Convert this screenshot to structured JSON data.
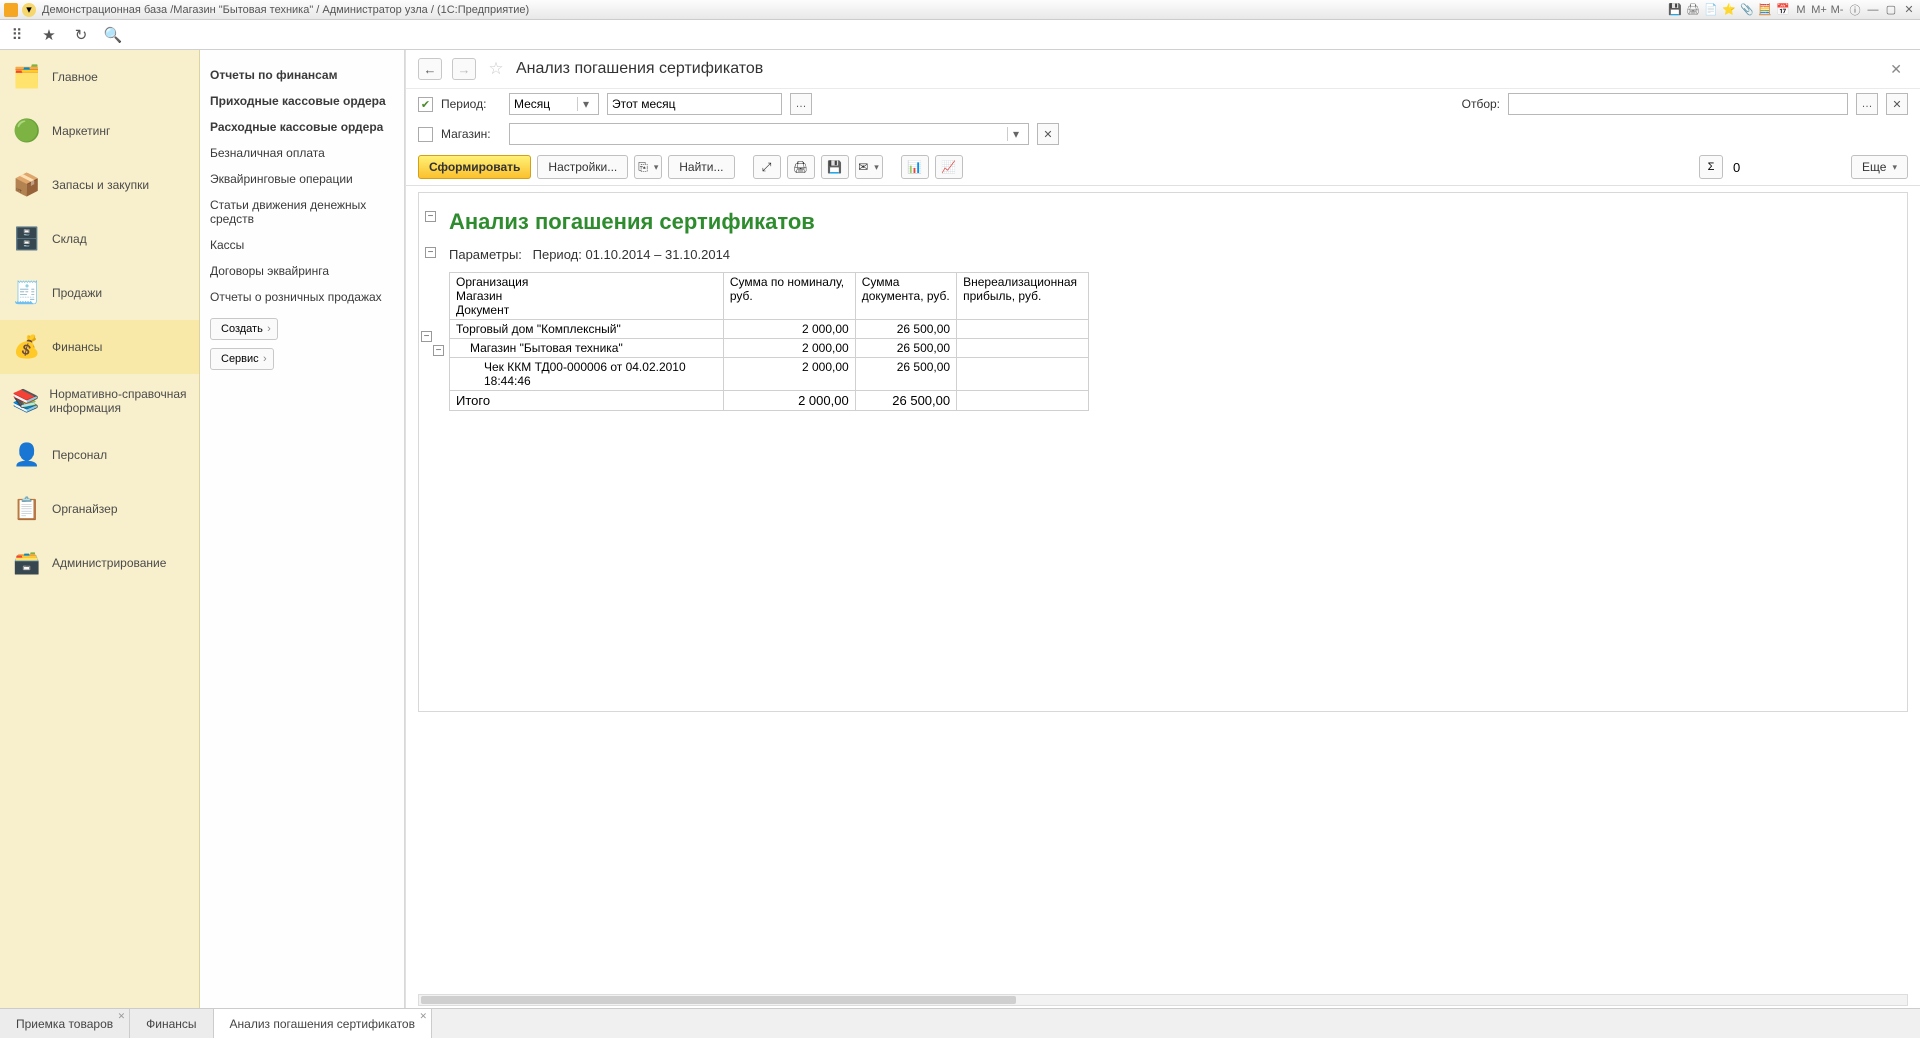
{
  "titlebar": {
    "text": "Демонстрационная база /Магазин \"Бытовая техника\" / Администратор узла /  (1С:Предприятие)",
    "mem": [
      "M",
      "M+",
      "M-"
    ]
  },
  "sidebar": {
    "items": [
      {
        "label": "Главное",
        "icon": "🗂️"
      },
      {
        "label": "Маркетинг",
        "icon": "🟢"
      },
      {
        "label": "Запасы и закупки",
        "icon": "📦"
      },
      {
        "label": "Склад",
        "icon": "🗄️"
      },
      {
        "label": "Продажи",
        "icon": "🧾"
      },
      {
        "label": "Финансы",
        "icon": "💰",
        "active": true
      },
      {
        "label": "Нормативно-справочная информация",
        "icon": "📚"
      },
      {
        "label": "Персонал",
        "icon": "👤"
      },
      {
        "label": "Органайзер",
        "icon": "📋"
      },
      {
        "label": "Администрирование",
        "icon": "🗃️"
      }
    ]
  },
  "submenu": {
    "items": [
      {
        "label": "Отчеты по финансам",
        "bold": true
      },
      {
        "label": "Приходные кассовые ордера",
        "bold": true
      },
      {
        "label": "Расходные кассовые ордера",
        "bold": true
      },
      {
        "label": "Безналичная оплата"
      },
      {
        "label": "Эквайринговые операции"
      },
      {
        "label": "Статьи движения денежных средств"
      },
      {
        "label": "Кассы"
      },
      {
        "label": "Договоры эквайринга"
      },
      {
        "label": "Отчеты о розничных продажах"
      }
    ],
    "buttons": [
      {
        "label": "Создать"
      },
      {
        "label": "Сервис"
      }
    ]
  },
  "content": {
    "title": "Анализ погашения сертификатов",
    "filters": {
      "period_label": "Период:",
      "period_type": "Месяц",
      "period_value": "Этот месяц",
      "selection_label": "Отбор:",
      "selection_value": "",
      "store_label": "Магазин:",
      "store_value": ""
    },
    "toolbar": {
      "generate": "Сформировать",
      "settings": "Настройки...",
      "find": "Найти...",
      "sum_value": "0",
      "more": "Еще"
    },
    "report": {
      "title": "Анализ погашения сертификатов",
      "params_label": "Параметры:",
      "params_value": "Период: 01.10.2014 – 31.10.2014",
      "headers": {
        "c1a": "Организация",
        "c1b": "Магазин",
        "c1c": "Документ",
        "c2": "Сумма по номиналу, руб.",
        "c3": "Сумма документа, руб.",
        "c4": "Внереализационная прибыль, руб."
      },
      "rows": [
        {
          "lvl": 0,
          "name": "Торговый дом \"Комплексный\"",
          "v1": "2 000,00",
          "v2": "26 500,00",
          "v3": ""
        },
        {
          "lvl": 1,
          "name": "Магазин \"Бытовая техника\"",
          "v1": "2 000,00",
          "v2": "26 500,00",
          "v3": ""
        },
        {
          "lvl": 2,
          "name": "Чек ККМ ТД00-000006 от 04.02.2010 18:44:46",
          "v1": "2 000,00",
          "v2": "26 500,00",
          "v3": ""
        }
      ],
      "total": {
        "label": "Итого",
        "v1": "2 000,00",
        "v2": "26 500,00",
        "v3": ""
      }
    }
  },
  "bottom_tabs": [
    {
      "label": "Приемка товаров"
    },
    {
      "label": "Финансы"
    },
    {
      "label": "Анализ погашения сертификатов",
      "active": true
    }
  ]
}
